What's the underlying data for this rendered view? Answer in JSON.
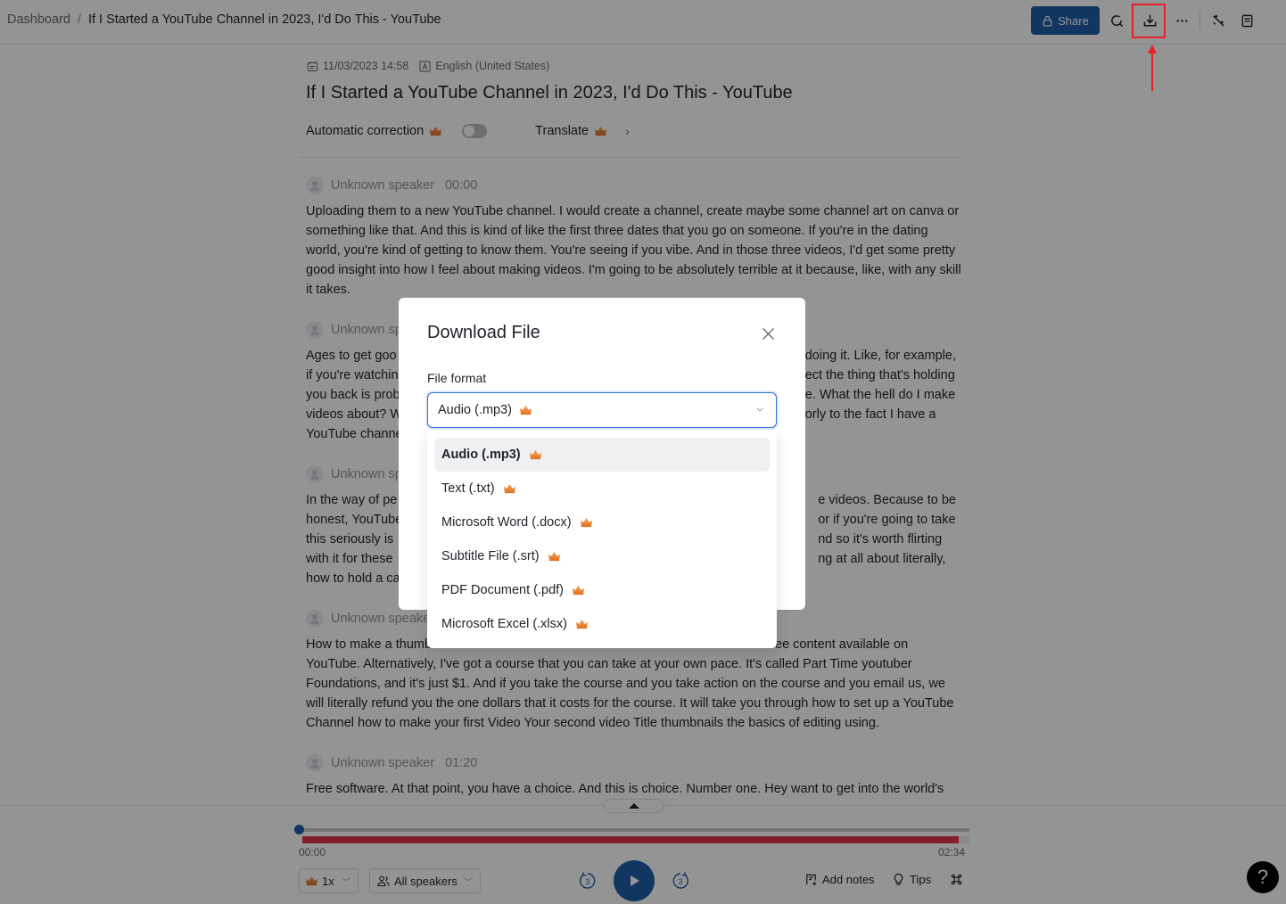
{
  "breadcrumb": {
    "home": "Dashboard",
    "separator": "/",
    "current": "If I Started a YouTube Channel in 2023, I'd Do This - YouTube"
  },
  "toolbar": {
    "share_label": "Share",
    "icons": [
      "lock-icon",
      "search-refresh-icon",
      "download-icon",
      "more-icon",
      "magic-wand-icon",
      "notes-icon"
    ],
    "highlighted": "download-icon",
    "annotation_color": "#e5212a"
  },
  "document": {
    "date": "11/03/2023 14:58",
    "language": "English (United States)",
    "title": "If I Started a YouTube Channel in 2023, I'd Do This - YouTube",
    "auto_correction_label": "Automatic correction",
    "auto_correction_on": false,
    "translate_label": "Translate"
  },
  "segments": [
    {
      "speaker": "Unknown speaker",
      "time": "00:00",
      "text": "Uploading them to a new YouTube channel. I would create a channel, create maybe some channel art on canva or something like that. And this is kind of like the first three dates that you go on someone. If you're in the dating world, you're kind of getting to know them. You're seeing if you vibe. And in those three videos, I'd get some pretty good insight into how I feel about making videos. I'm going to be absolutely terrible at it because, like, with any skill it takes."
    },
    {
      "speaker": "Unknown speaker",
      "time": "",
      "text": "Ages to get good ... doing it. Like, for example, if you're watching ... ect the thing that's holding you back is prob ... e. What the hell do I make videos about? W ... orly to the fact I have a YouTube channe"
    },
    {
      "speaker": "Unknown speaker",
      "time": "",
      "text": "In the way of pe ... e videos. Because to be honest, YouTube ... or if you're going to take this seriously is ... nd so it's worth flirting with it for these ... ng at all about literally, how to hold a ca"
    },
    {
      "speaker": "Unknown speaker",
      "time": "",
      "text": "How to make a thumb ... ee content available on YouTube. Alternatively, I've got a course that you can take at your own pace. It's called Part Time youtuber Foundations, and it's just $1. And if you take the course and you take action on the course and you email us, we will literally refund you the one dollars that it costs for the course. It will take you through how to set up a YouTube Channel how to make your first Video Your second video Title thumbnails the basics of editing using."
    },
    {
      "speaker": "Unknown speaker",
      "time": "01:20",
      "text": "Free software. At that point, you have a choice. And this is choice. Number one. Hey want to get into the world's"
    }
  ],
  "segment_fragments": {
    "s1": {
      "left": [
        "Ages to get goo",
        "if you're watchin",
        "you back is prob",
        "videos about? W",
        "YouTube channe"
      ],
      "right": [
        "doing it. Like, for example,",
        "ect the thing that's holding",
        "e. What the hell do I make",
        "orly to the fact I have a",
        ""
      ]
    },
    "s2": {
      "left": [
        "In the way of pe",
        "honest, YouTube",
        "this seriously is",
        "with it for these",
        "how to hold a ca"
      ],
      "right": [
        "e videos. Because to be",
        "or if you're going to take",
        "nd so it's worth flirting",
        "ng at all about literally,",
        ""
      ]
    },
    "s3": {
      "left": [
        "How to make a thumb"
      ],
      "right": [
        "ee content available on"
      ],
      "rest": "YouTube. Alternatively, I've got a course that you can take at your own pace. It's called Part Time youtuber Foundations, and it's just $1. And if you take the course and you take action on the course and you email us, we will literally refund you the one dollars that it costs for the course. It will take you through how to set up a YouTube Channel how to make your first Video Your second video Title thumbnails the basics of editing using."
    },
    "s1_speaker_partial": "Unknown sp",
    "s2_speaker_partial": "Unknown sp",
    "s3_speaker_partial": "Unknown speake"
  },
  "player": {
    "current_time": "00:00",
    "total_time": "02:34",
    "progress": 0,
    "speed": "1x",
    "speaker_filter": "All speakers",
    "rewind_seconds": "3",
    "forward_seconds": "3",
    "add_notes_label": "Add notes",
    "tips_label": "Tips",
    "accent_color": "#1d5ea8",
    "waveform_color": "#e0344f"
  },
  "modal": {
    "title": "Download File",
    "field_label": "File format",
    "selected_value": "Audio (.mp3)",
    "options": [
      {
        "label": "Audio (.mp3)",
        "premium": true,
        "selected": true
      },
      {
        "label": "Text (.txt)",
        "premium": true,
        "selected": false
      },
      {
        "label": "Microsoft Word (.docx)",
        "premium": true,
        "selected": false
      },
      {
        "label": "Subtitle File (.srt)",
        "premium": true,
        "selected": false
      },
      {
        "label": "PDF Document (.pdf)",
        "premium": true,
        "selected": false
      },
      {
        "label": "Microsoft Excel (.xlsx)",
        "premium": true,
        "selected": false
      }
    ]
  },
  "help": {
    "label": "?"
  }
}
